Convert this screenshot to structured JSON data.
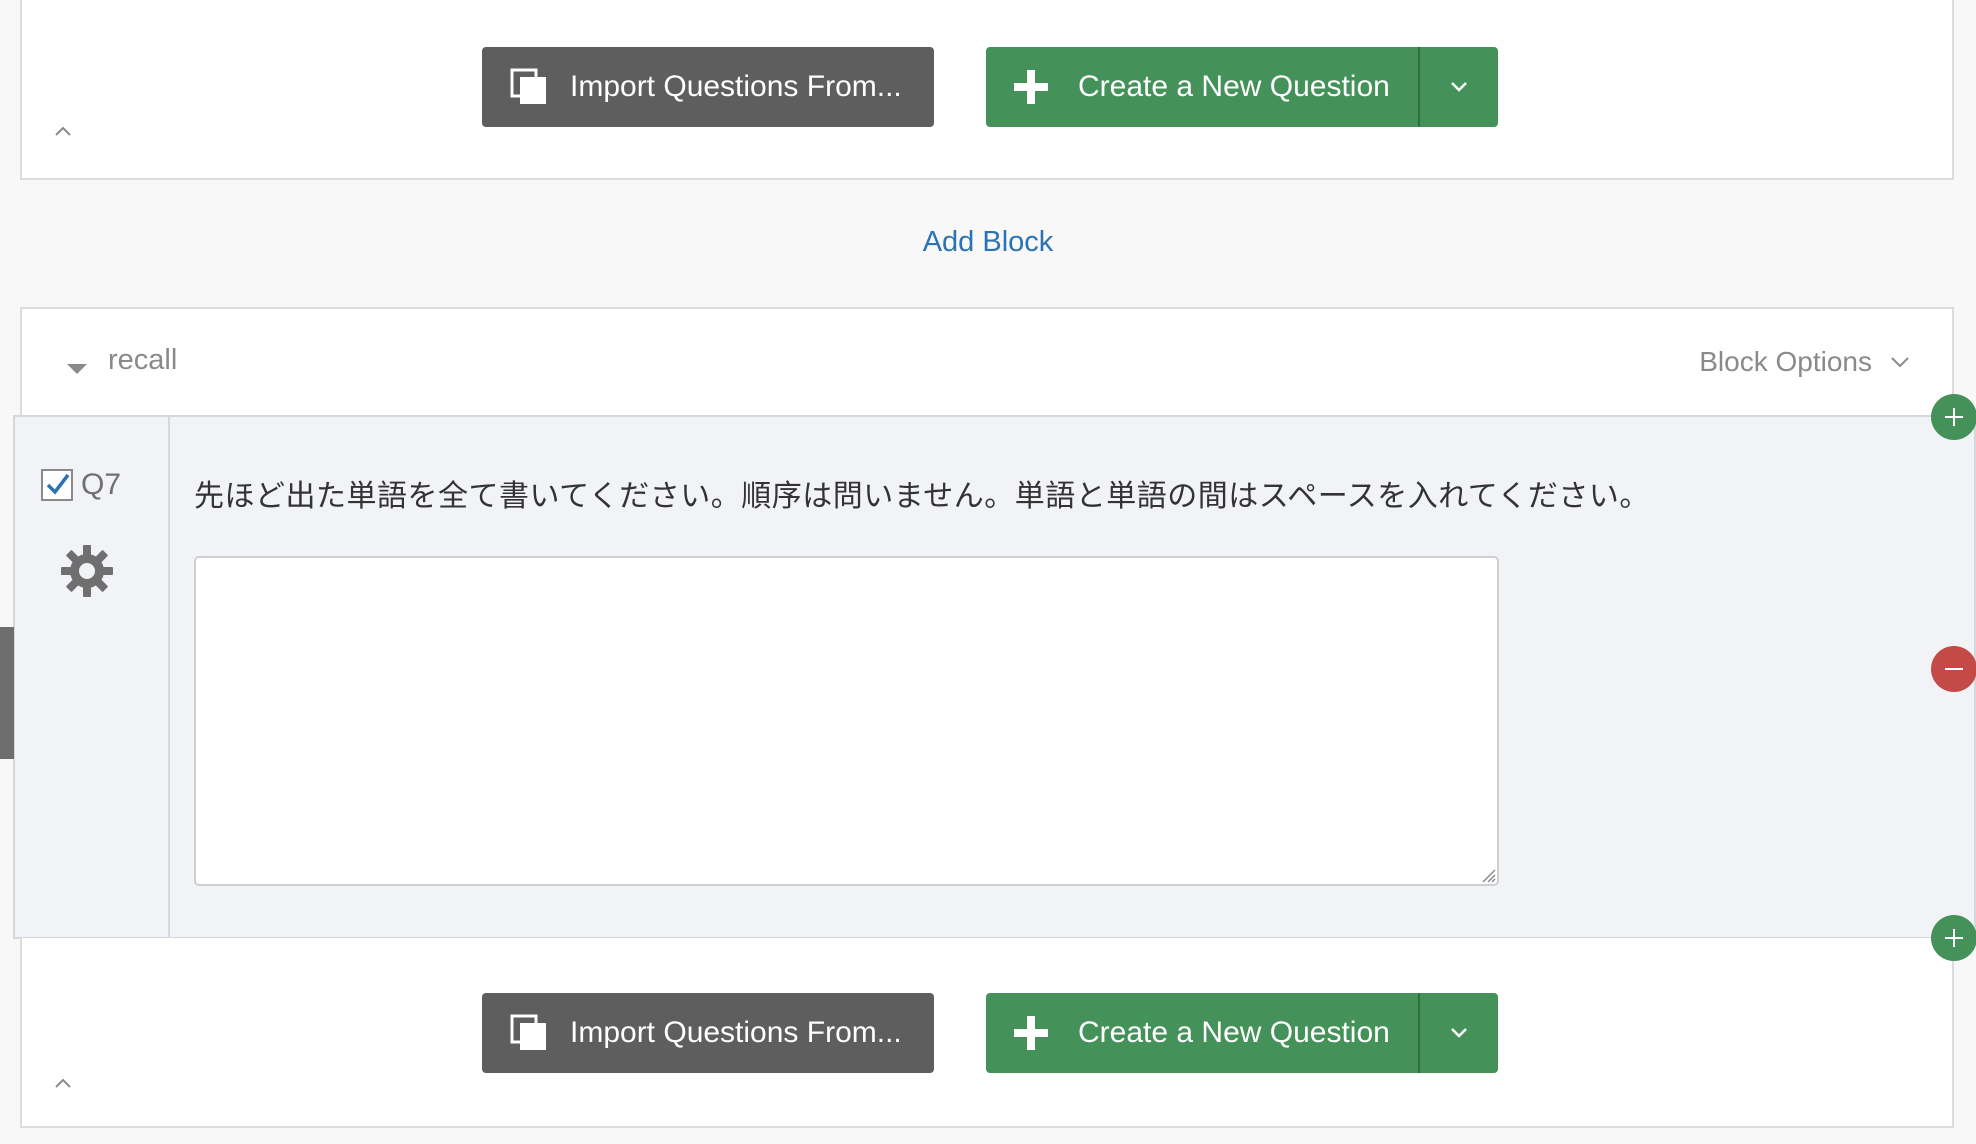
{
  "top_footer": {
    "import_label": "Import Questions From...",
    "create_label": "Create a New Question"
  },
  "add_block_label": "Add Block",
  "block": {
    "name": "recall",
    "options_label": "Block Options"
  },
  "question": {
    "number": "Q7",
    "checked": true,
    "text": "先ほど出た単語を全て書いてください。順序は問いません。単語と単語の間はスペースを入れてください。",
    "answer_value": ""
  },
  "bottom_footer": {
    "import_label": "Import Questions From...",
    "create_label": "Create a New Question"
  },
  "colors": {
    "green": "#44925a",
    "red": "#c44a47",
    "dark_button": "#5e5e5e",
    "link_blue": "#2b73b6"
  },
  "icons": {
    "import": "copy-pages-icon",
    "create": "plus-icon",
    "dropdown": "chevron-down-icon",
    "collapse": "chevron-up-icon",
    "block_toggle": "caret-down-icon",
    "settings": "gear-icon",
    "add_question": "plus-circle-icon",
    "remove_question": "minus-circle-icon"
  }
}
